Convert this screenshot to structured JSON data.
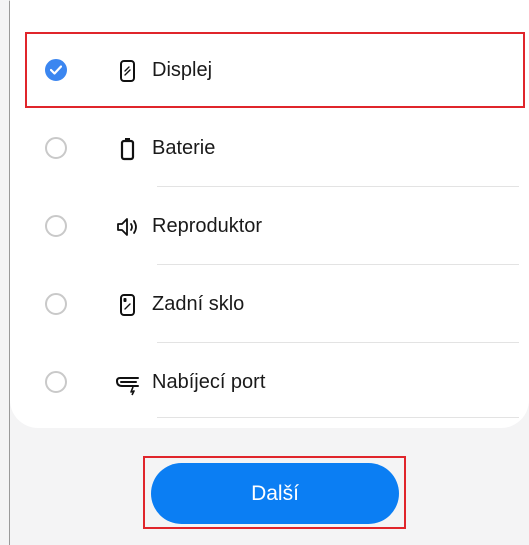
{
  "options": [
    {
      "label": "Displej",
      "selected": true,
      "icon": "phone-display-icon"
    },
    {
      "label": "Baterie",
      "selected": false,
      "icon": "battery-icon"
    },
    {
      "label": "Reproduktor",
      "selected": false,
      "icon": "speaker-icon"
    },
    {
      "label": "Zadní sklo",
      "selected": false,
      "icon": "back-glass-icon"
    },
    {
      "label": "Nabíjecí port",
      "selected": false,
      "icon": "charging-port-icon"
    }
  ],
  "next_button": {
    "label": "Další"
  },
  "colors": {
    "accent": "#0b7ef3",
    "check": "#3b86f0",
    "highlight": "#e0252b"
  }
}
